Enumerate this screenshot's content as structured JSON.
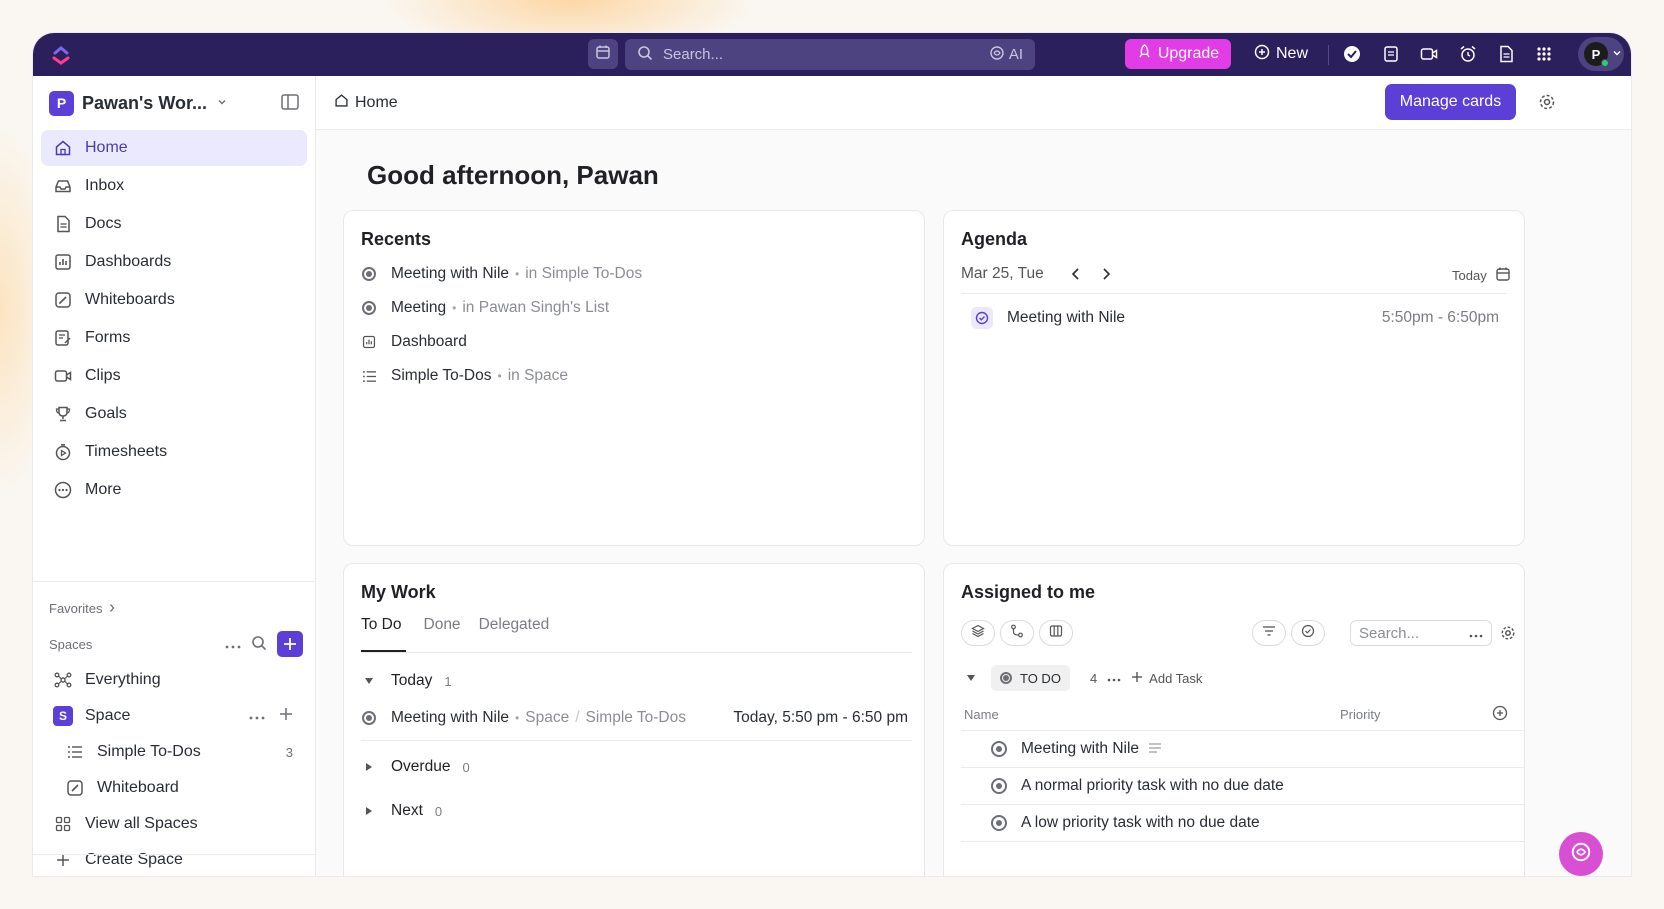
{
  "topbar": {
    "search_placeholder": "Search...",
    "ai_label": "AI",
    "upgrade_label": "Upgrade",
    "new_label": "New",
    "avatar_initial": "P"
  },
  "sidebar": {
    "workspace_initial": "P",
    "workspace_name": "Pawan's Wor...",
    "nav": [
      {
        "label": "Home",
        "icon": "home-icon",
        "active": true
      },
      {
        "label": "Inbox",
        "icon": "inbox-icon"
      },
      {
        "label": "Docs",
        "icon": "doc-icon"
      },
      {
        "label": "Dashboards",
        "icon": "dashboard-icon"
      },
      {
        "label": "Whiteboards",
        "icon": "whiteboard-icon"
      },
      {
        "label": "Forms",
        "icon": "form-icon"
      },
      {
        "label": "Clips",
        "icon": "video-icon"
      },
      {
        "label": "Goals",
        "icon": "trophy-icon"
      },
      {
        "label": "Timesheets",
        "icon": "timer-icon"
      },
      {
        "label": "More",
        "icon": "more-icon"
      }
    ],
    "favorites_label": "Favorites",
    "spaces_label": "Spaces",
    "everything_label": "Everything",
    "space_initial": "S",
    "space_name": "Space",
    "list_name": "Simple To-Dos",
    "list_count": "3",
    "whiteboard_name": "Whiteboard",
    "view_all_label": "View all Spaces",
    "create_label": "Create Space"
  },
  "header": {
    "breadcrumb": "Home",
    "manage_cards_label": "Manage cards"
  },
  "greeting": "Good afternoon, Pawan",
  "recents": {
    "title": "Recents",
    "items": [
      {
        "name": "Meeting with Nile",
        "location": "in Simple To-Dos"
      },
      {
        "name": "Meeting",
        "location": "in Pawan Singh's List"
      },
      {
        "name": "Dashboard",
        "location": ""
      },
      {
        "name": "Simple To-Dos",
        "location": "in Space"
      }
    ]
  },
  "agenda": {
    "title": "Agenda",
    "date": "Mar 25, Tue",
    "today_label": "Today",
    "event_name": "Meeting with Nile",
    "event_time": "5:50pm - 6:50pm"
  },
  "my_work": {
    "title": "My Work",
    "tabs": [
      "To Do",
      "Done",
      "Delegated"
    ],
    "today_label": "Today",
    "today_count": "1",
    "task_name": "Meeting with Nile",
    "task_space": "Space",
    "task_list": "Simple To-Dos",
    "task_time": "Today, 5:50 pm - 6:50 pm",
    "overdue_label": "Overdue",
    "overdue_count": "0",
    "next_label": "Next",
    "next_count": "0"
  },
  "assigned": {
    "title": "Assigned to me",
    "search_placeholder": "Search...",
    "status_label": "TO DO",
    "status_count": "4",
    "add_task_label": "Add Task",
    "col_name": "Name",
    "col_priority": "Priority",
    "tasks": [
      "Meeting with Nile",
      "A normal priority task with no due date",
      "A low priority task with no due date"
    ]
  },
  "colors": {
    "accent": "#5b3fd6",
    "topbar": "#2b1f5c",
    "upgrade": "#e13ce6"
  }
}
